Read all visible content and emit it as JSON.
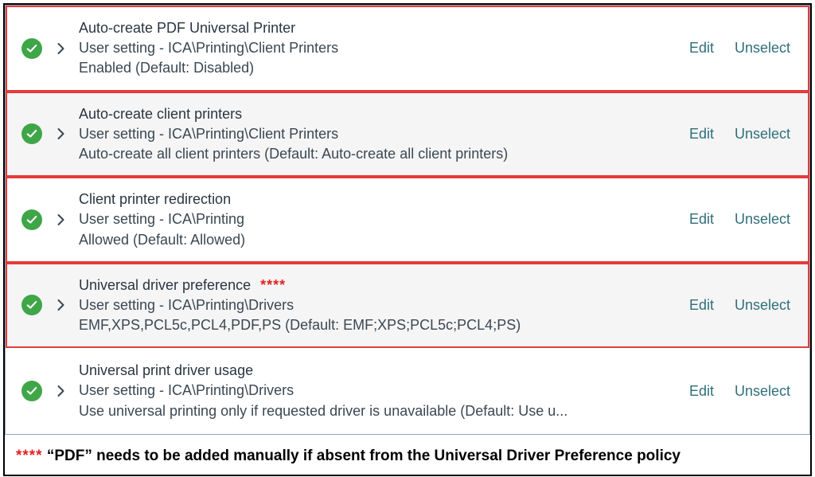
{
  "actions": {
    "edit": "Edit",
    "unselect": "Unselect"
  },
  "rows": [
    {
      "title": "Auto-create PDF Universal Printer",
      "path": "User setting - ICA\\Printing\\Client Printers",
      "value": "Enabled (Default: Disabled)",
      "asterisks": "",
      "alt": false,
      "redBorder": true
    },
    {
      "title": "Auto-create client printers",
      "path": "User setting - ICA\\Printing\\Client Printers",
      "value": "Auto-create all client printers (Default: Auto-create all client printers)",
      "asterisks": "",
      "alt": true,
      "redBorder": true
    },
    {
      "title": "Client printer redirection",
      "path": "User setting - ICA\\Printing",
      "value": "Allowed (Default: Allowed)",
      "asterisks": "",
      "alt": false,
      "redBorder": true
    },
    {
      "title": "Universal driver preference",
      "path": "User setting - ICA\\Printing\\Drivers",
      "value": "EMF,XPS,PCL5c,PCL4,PDF,PS (Default: EMF;XPS;PCL5c;PCL4;PS)",
      "asterisks": "****",
      "alt": true,
      "redBorder": true
    },
    {
      "title": "Universal print driver usage",
      "path": "User setting - ICA\\Printing\\Drivers",
      "value": "Use universal printing only if requested driver is unavailable (Default: Use u...",
      "asterisks": "",
      "alt": false,
      "redBorder": false
    }
  ],
  "footnote": {
    "stars": "****",
    "text": " “PDF” needs to be added manually if absent from the Universal Driver Preference policy"
  }
}
